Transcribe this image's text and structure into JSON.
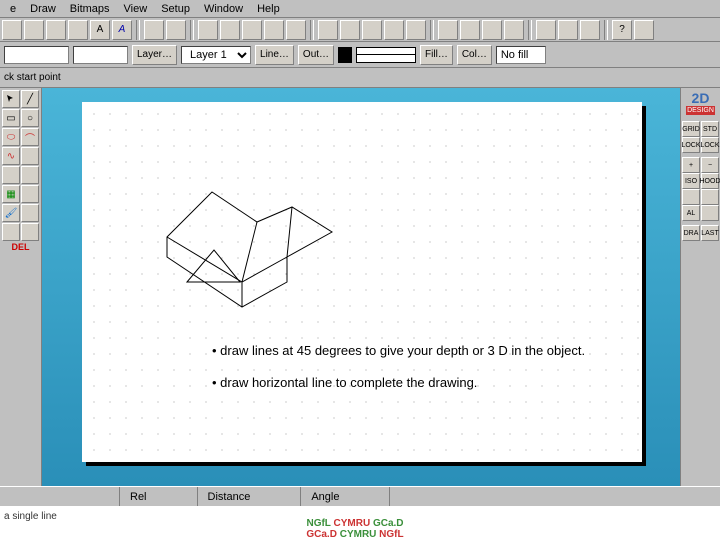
{
  "menu": {
    "items": [
      "e",
      "Draw",
      "Bitmaps",
      "View",
      "Setup",
      "Window",
      "Help"
    ]
  },
  "toolbar2": {
    "layer_btn": "Layer…",
    "layer_value": "Layer 1",
    "line_btn": "Line…",
    "out_btn": "Out…",
    "fill_btn": "Fill…",
    "col_btn": "Col…",
    "fill_value": "No fill"
  },
  "toolbar3": {
    "hint": "ck start point"
  },
  "left_tools": {
    "del": "DEL"
  },
  "right": {
    "logo": "2D",
    "design": "DESIGN",
    "grid": "GRID",
    "std": "STD",
    "lock": "LOCK",
    "lock2": "LOCK",
    "iso": "ISO",
    "hood": "HOOD",
    "al": "AL",
    "dra": "DRA",
    "last": "LAST"
  },
  "instructions": {
    "line1": "• draw lines at 45 degrees to give your depth or 3 D in the object.",
    "line2": "• draw horizontal line to complete the drawing."
  },
  "status": {
    "rel": "Rel",
    "distance": "Distance",
    "angle": "Angle",
    "footer_hint": "a single line"
  },
  "footer": {
    "l1a": "NGfL",
    "l1b": "CYMRU",
    "l1c": "GCa.D",
    "l2a": "GCa.D",
    "l2b": "CYMRU",
    "l2c": "NGfL"
  }
}
